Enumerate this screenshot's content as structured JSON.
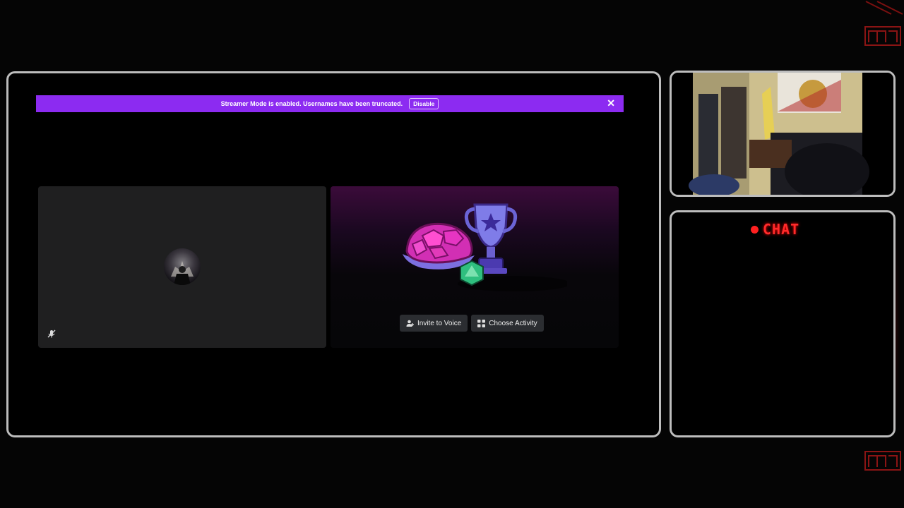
{
  "banner": {
    "message": "Streamer Mode is enabled. Usernames have been truncated.",
    "disable_label": "Disable",
    "close_glyph": "✕"
  },
  "voice_tile": {
    "avatar_icon": "user-avatar",
    "mute_icon": "mic-off-icon"
  },
  "activity_tile": {
    "invite_label": "Invite to Voice",
    "activity_label": "Choose Activity",
    "invite_icon": "person-add-icon",
    "activity_icon": "grid-icon"
  },
  "chat": {
    "title": "CHAT",
    "accent_color": "#ff2020"
  },
  "colors": {
    "banner_bg": "#8c2bf1",
    "frame_border": "#bdbdbd",
    "tile_bg": "#1f1f20"
  }
}
